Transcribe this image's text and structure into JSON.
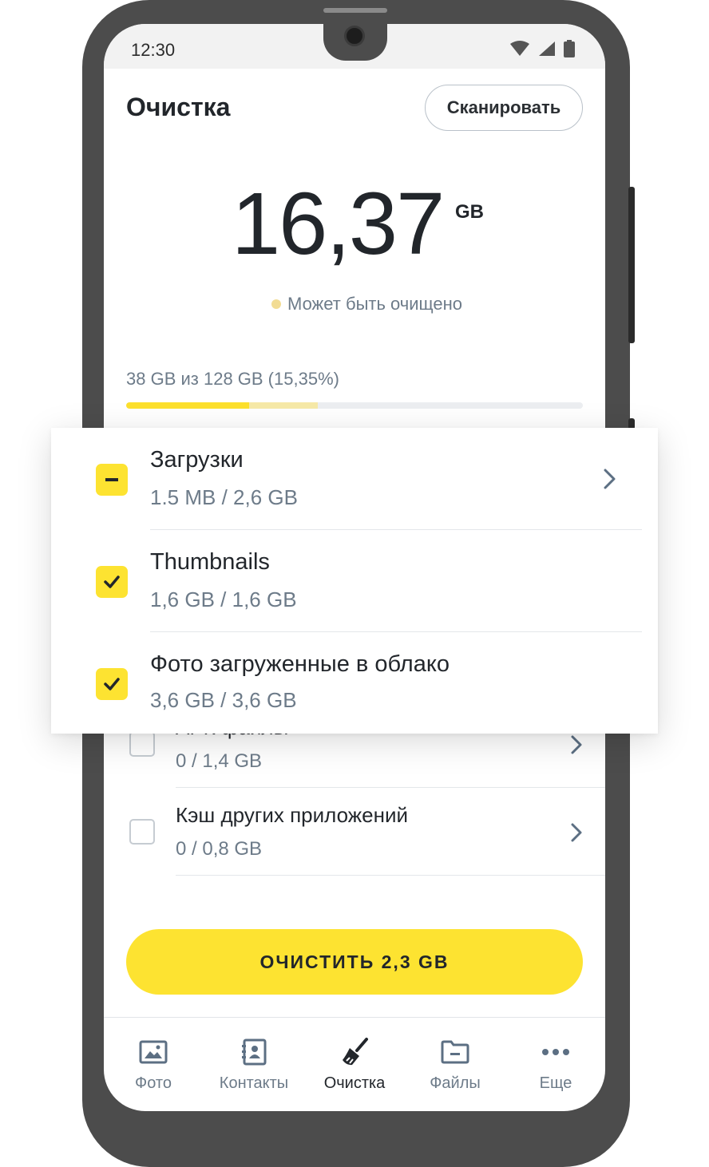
{
  "status": {
    "time": "12:30"
  },
  "header": {
    "title": "Очистка",
    "scan_label": "Сканировать"
  },
  "summary": {
    "amount": "16,37",
    "unit": "GB",
    "note": "Может быть очищено",
    "usage_text": "38 GB из 128 GB (15,35%)",
    "used_fraction": 0.27,
    "cleanable_fraction": 0.15
  },
  "background_list": [
    {
      "title": "АРК файлы",
      "size": "0 / 1,4 GB",
      "checked": false
    },
    {
      "title": "Кэш других приложений",
      "size": "0 / 0,8 GB",
      "checked": false
    }
  ],
  "overlay_list": [
    {
      "title": "Загрузки",
      "size": "1.5 MB / 2,6 GB",
      "state": "partial"
    },
    {
      "title": "Thumbnails",
      "size": "1,6 GB / 1,6 GB",
      "state": "checked"
    },
    {
      "title": "Фото загруженные в облако",
      "size": "3,6 GB / 3,6 GB",
      "state": "checked"
    }
  ],
  "clean_button": {
    "label": "ОЧИСТИТЬ 2,3 GB"
  },
  "nav": [
    {
      "label": "Фото",
      "icon": "image-icon"
    },
    {
      "label": "Контакты",
      "icon": "contacts-icon"
    },
    {
      "label": "Очистка",
      "icon": "broom-icon",
      "active": true
    },
    {
      "label": "Файлы",
      "icon": "folder-icon"
    },
    {
      "label": "Еще",
      "icon": "more-icon"
    }
  ],
  "colors": {
    "accent": "#fde331",
    "text_primary": "#22262b",
    "text_secondary": "#6d7b89"
  }
}
